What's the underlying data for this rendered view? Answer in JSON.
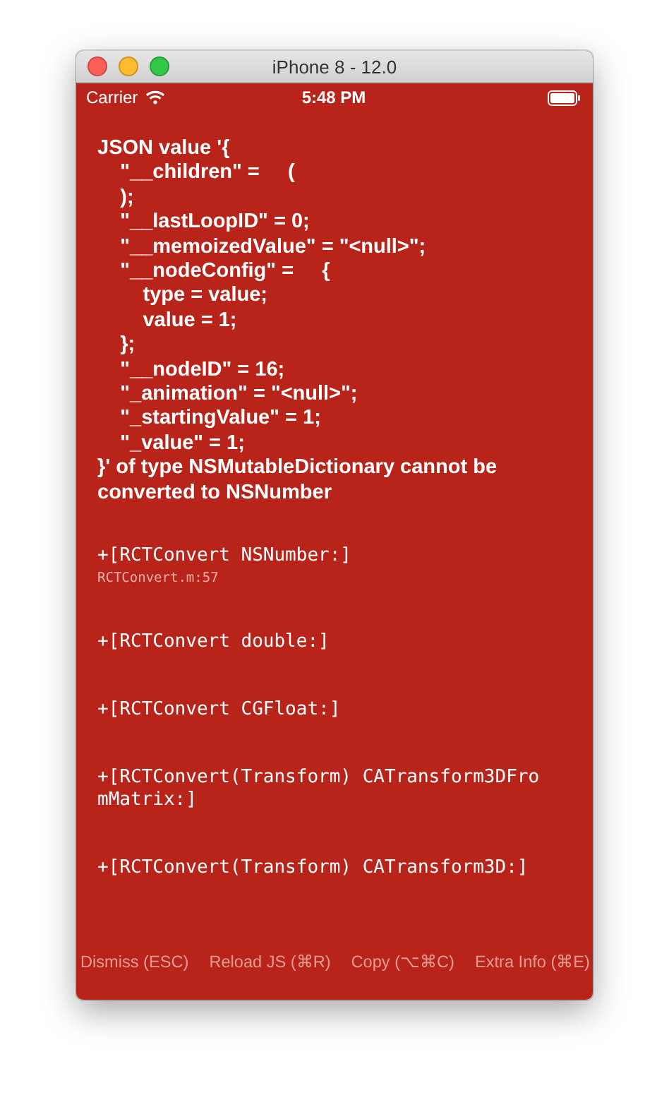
{
  "window": {
    "title": "iPhone 8 - 12.0"
  },
  "status_bar": {
    "carrier": "Carrier",
    "time": "5:48 PM"
  },
  "error": {
    "message": "JSON value '{\n    \"__children\" =     (\n    );\n    \"__lastLoopID\" = 0;\n    \"__memoizedValue\" = \"<null>\";\n    \"__nodeConfig\" =     {\n        type = value;\n        value = 1;\n    };\n    \"__nodeID\" = 16;\n    \"_animation\" = \"<null>\";\n    \"_startingValue\" = 1;\n    \"_value\" = 1;\n}' of type NSMutableDictionary cannot be converted to NSNumber"
  },
  "stack": [
    {
      "method": "+[RCTConvert NSNumber:]",
      "file": "RCTConvert.m:57"
    },
    {
      "method": "+[RCTConvert double:]"
    },
    {
      "method": "+[RCTConvert CGFloat:]"
    },
    {
      "method": "+[RCTConvert(Transform) CATransform3DFromMatrix:]"
    },
    {
      "method": "+[RCTConvert(Transform) CATransform3D:]"
    }
  ],
  "buttons": [
    "Dismiss (ESC)",
    "Reload JS (⌘R)",
    "Copy (⌥⌘C)",
    "Extra Info (⌘E)"
  ]
}
